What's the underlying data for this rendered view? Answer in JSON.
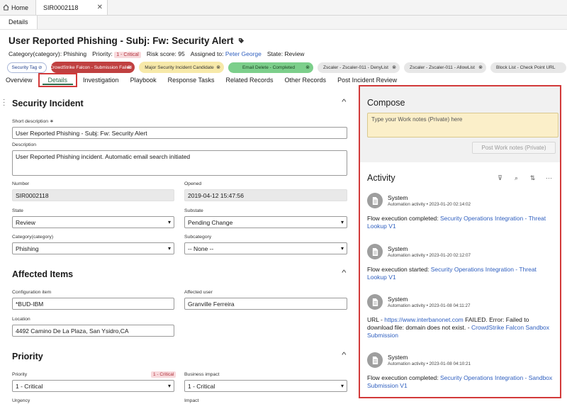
{
  "top": {
    "home": "Home",
    "record_tab": "SIR0002118",
    "close": "✕",
    "subtab": "Details"
  },
  "header": {
    "title": "User Reported Phishing - Subj: Fw: Security Alert",
    "category_label": "Category(category):",
    "category_value": "Phishing",
    "priority_label": "Priority:",
    "priority_value": "1 - Critical",
    "risk_label": "Risk score:",
    "risk_value": "95",
    "assigned_label": "Assigned to:",
    "assigned_value": "Peter George",
    "state_label": "State:",
    "state_value": "Review"
  },
  "tags": [
    "Security Tag",
    "CrowdStrike Falcon - Submission Failed",
    "Major Security Incident Candidate",
    "Email Delete - Completed",
    "Zscaler - Zscaler-011 - DenyList",
    "Zscaler - Zscaler-011 - AllowList",
    "Block List - Check Point URL"
  ],
  "nav_tabs": [
    "Overview",
    "Details",
    "Investigation",
    "Playbook",
    "Response Tasks",
    "Related Records",
    "Other Records",
    "Post Incident Review"
  ],
  "form": {
    "security_heading": "Security Incident",
    "short_desc_label": "Short description",
    "short_desc_req": "∗",
    "short_desc_value": "User Reported Phishing - Subj: Fw: Security Alert",
    "description_label": "Description",
    "description_value": "User Reported Phishing incident. Automatic email search initiated",
    "number_label": "Number",
    "number_value": "SIR0002118",
    "opened_label": "Opened",
    "opened_value": "2019-04-12 15:47:56",
    "state_label": "State",
    "state_value": "Review",
    "substate_label": "Substate",
    "substate_value": "Pending Change",
    "category_label": "Category(category)",
    "category_value": "Phishing",
    "subcategory_label": "Subcategory",
    "subcategory_value": "-- None --",
    "affected_heading": "Affected Items",
    "ci_label": "Configuration item",
    "ci_value": "*BUD-IBM",
    "affected_user_label": "Affected user",
    "affected_user_value": "Granville Ferreira",
    "location_label": "Location",
    "location_value": "4492 Camino De La Plaza, San Ysidro,CA",
    "priority_heading": "Priority",
    "priority_label": "Priority",
    "priority_badge": "1 - Critical",
    "priority_value": "1 - Critical",
    "impact_label": "Business impact",
    "impact_value": "1 - Critical",
    "urgency_label": "Urgency",
    "impact2_label": "Impact"
  },
  "compose": {
    "heading": "Compose",
    "placeholder": "Type your Work notes (Private) here",
    "post_button": "Post Work notes (Private)"
  },
  "activity": {
    "heading": "Activity",
    "entries": [
      {
        "name": "System",
        "meta": "Automation activity • 2023-01-20 02:14:02",
        "text": "Flow execution completed: ",
        "link": "Security Operations Integration - Threat Lookup V1"
      },
      {
        "name": "System",
        "meta": "Automation activity • 2023-01-20 02:12:07",
        "text": "Flow execution started: ",
        "link": "Security Operations Integration - Threat Lookup V1"
      },
      {
        "name": "System",
        "meta": "Automation activity • 2023-01-08 04:11:27",
        "text_pre": "URL - ",
        "url": "https://www.interbanonet.com",
        "text": " FAILED. Error: Failed to download file: domain does not exist. - ",
        "link": "CrowdStrike Falcon Sandbox Submission"
      },
      {
        "name": "System",
        "meta": "Automation activity • 2023-01-08 04:10:21",
        "text": "Flow execution completed: ",
        "link": "Security Operations Integration - Sandbox Submission V1"
      }
    ]
  },
  "colors": {
    "accent_green": "#2f6b4a",
    "link_blue": "#2f5fbf",
    "critical_bg": "#f8d9dc",
    "highlight_red": "#d23a3a"
  }
}
